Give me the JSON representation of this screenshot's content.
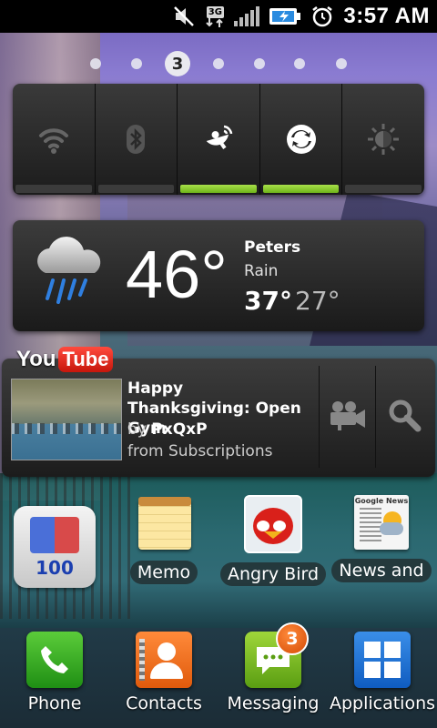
{
  "status_bar": {
    "time": "3:57 AM",
    "network_label": "3G",
    "icons": [
      "mute-icon",
      "3g-data-icon",
      "signal-icon",
      "battery-charging-icon",
      "alarm-icon"
    ]
  },
  "home": {
    "page_indicator": {
      "current": "3",
      "total_pages": 7
    }
  },
  "power_widget": {
    "toggles": [
      {
        "name": "wifi",
        "icon": "wifi-icon",
        "on": false
      },
      {
        "name": "bluetooth",
        "icon": "bluetooth-icon",
        "on": false
      },
      {
        "name": "gps",
        "icon": "gps-icon",
        "on": true
      },
      {
        "name": "sync",
        "icon": "sync-icon",
        "on": true
      },
      {
        "name": "brightness",
        "icon": "brightness-icon",
        "on": false
      }
    ],
    "accent_color": "#8ccf2e"
  },
  "weather": {
    "temperature": "46°",
    "city": "Peters",
    "condition": "Rain",
    "high": "37°",
    "low": "27°",
    "icon": "rain-cloud-icon"
  },
  "youtube": {
    "logo_you": "You",
    "logo_tube": "Tube",
    "video_title": "Happy Thanksgiving: Open Gym",
    "by_prefix": "by",
    "author": "PxQxP",
    "source": "from Subscriptions",
    "buttons": [
      "record-video-icon",
      "search-icon"
    ],
    "accent_color": "#e0261a"
  },
  "apps": [
    {
      "label": "",
      "icon": "memory-booster-icon",
      "badge_text": "100"
    },
    {
      "label": "Memo",
      "icon": "memo-icon"
    },
    {
      "label": "Angry Bird",
      "icon": "angry-birds-icon"
    },
    {
      "label": "News and",
      "icon": "news-weather-icon",
      "icon_text": "Google News"
    }
  ],
  "dock": [
    {
      "label": "Phone",
      "icon": "phone-icon"
    },
    {
      "label": "Contacts",
      "icon": "contacts-icon"
    },
    {
      "label": "Messaging",
      "icon": "messaging-icon",
      "badge": "3"
    },
    {
      "label": "Applications",
      "icon": "applications-grid-icon"
    }
  ]
}
